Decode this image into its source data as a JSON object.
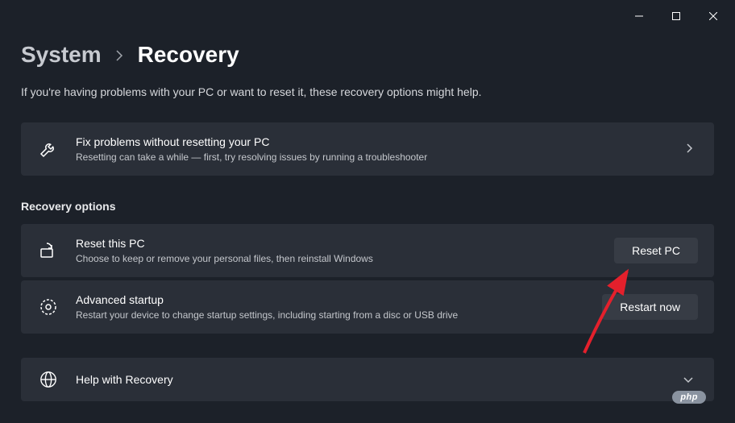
{
  "window": {
    "minimize_label": "Minimize",
    "maximize_label": "Maximize",
    "close_label": "Close"
  },
  "breadcrumb": {
    "parent": "System",
    "current": "Recovery"
  },
  "intro": "If you're having problems with your PC or want to reset it, these recovery options might help.",
  "fix": {
    "title": "Fix problems without resetting your PC",
    "subtitle": "Resetting can take a while — first, try resolving issues by running a troubleshooter"
  },
  "section_header": "Recovery options",
  "reset": {
    "title": "Reset this PC",
    "subtitle": "Choose to keep or remove your personal files, then reinstall Windows",
    "button": "Reset PC"
  },
  "advanced": {
    "title": "Advanced startup",
    "subtitle": "Restart your device to change startup settings, including starting from a disc or USB drive",
    "button": "Restart now"
  },
  "help": {
    "title": "Help with Recovery"
  },
  "badge": "php"
}
